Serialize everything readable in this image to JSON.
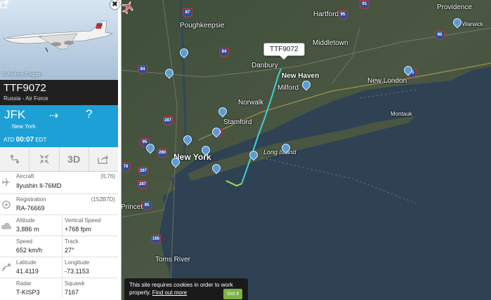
{
  "photo": {
    "copyright": "© Andrew Coggan"
  },
  "flight": {
    "callsign": "TTF9072",
    "operator": "Russia - Air Force",
    "from_code": "JFK",
    "from_city": "New York",
    "to_code": "?",
    "atd_label": "ATD",
    "atd_time": "00:07",
    "atd_tz": "EDT"
  },
  "toolbar": {
    "three_d": "3D"
  },
  "aircraft": {
    "label": "Aircraft",
    "code": "(IL76)",
    "value": "Ilyushin Il-76MD",
    "reg_label": "Registration",
    "reg_code": "(152B7D)",
    "reg_value": "RA-76669",
    "alt_label": "Altitude",
    "alt_value": "3,886 m",
    "vs_label": "Vertical Speed",
    "vs_value": "+768 fpm",
    "speed_label": "Speed",
    "speed_value": "652 km/h",
    "track_label": "Track",
    "track_value": "27°",
    "lat_label": "Latitude",
    "lat_value": "41.4119",
    "lon_label": "Longitude",
    "lon_value": "-73.1153",
    "radar_label": "Radar",
    "radar_value": "T-KISP3",
    "squawk_label": "Squawk",
    "squawk_value": "7167"
  },
  "map": {
    "flight_label": "TTF9072",
    "cities": [
      "Hartford",
      "Providence",
      "Poughkeepsie",
      "Middletown",
      "Danbury",
      "New Haven",
      "Milford",
      "New London",
      "Norwalk",
      "Montauk",
      "Stamford",
      "Long Island",
      "New York",
      "Toms River",
      "Warwick",
      "Princeton"
    ],
    "highways": [
      "87",
      "84",
      "84",
      "684",
      "91",
      "95",
      "95",
      "95",
      "287",
      "95",
      "287",
      "280",
      "78",
      "287",
      "95",
      "195"
    ]
  },
  "cookie": {
    "text": "This site requires cookies in order to work properly.",
    "link": "Find out more",
    "button": "Got it"
  }
}
